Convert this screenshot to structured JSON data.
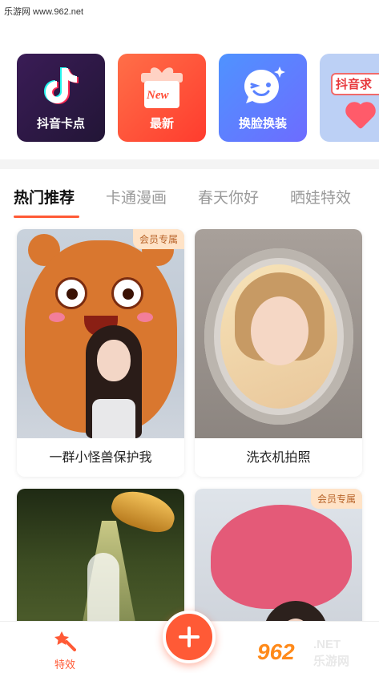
{
  "watermark": {
    "site_text": "乐游网 www.962.net",
    "logo_number": "962",
    "logo_domain": ".NET",
    "logo_cn": "乐游网"
  },
  "quick_tiles": [
    {
      "label": "抖音卡点",
      "icon": "tiktok-note-icon",
      "color": "#2a1840"
    },
    {
      "label": "最新",
      "icon": "gift-box-icon",
      "badge_text": "New",
      "color": "#ff4d36"
    },
    {
      "label": "换脸换装",
      "icon": "face-wink-icon",
      "color": "#5a82ff"
    },
    {
      "label": "抖音求",
      "icon": "heart-icon",
      "color": "#bcd0f5"
    }
  ],
  "tabs": [
    {
      "label": "热门推荐",
      "active": true
    },
    {
      "label": "卡通漫画",
      "active": false
    },
    {
      "label": "春天你好",
      "active": false
    },
    {
      "label": "晒娃特效",
      "active": false
    }
  ],
  "accent_color": "#ff5a36",
  "cards": [
    {
      "caption": "一群小怪兽保护我",
      "badge": "会员专属"
    },
    {
      "caption": "洗衣机拍照",
      "badge": ""
    },
    {
      "caption": "",
      "badge": ""
    },
    {
      "caption": "",
      "badge": "会员专属"
    }
  ],
  "bottom_nav": {
    "effects_label": "特效",
    "effects_icon": "magic-wand-icon",
    "fab_icon": "plus-icon"
  }
}
